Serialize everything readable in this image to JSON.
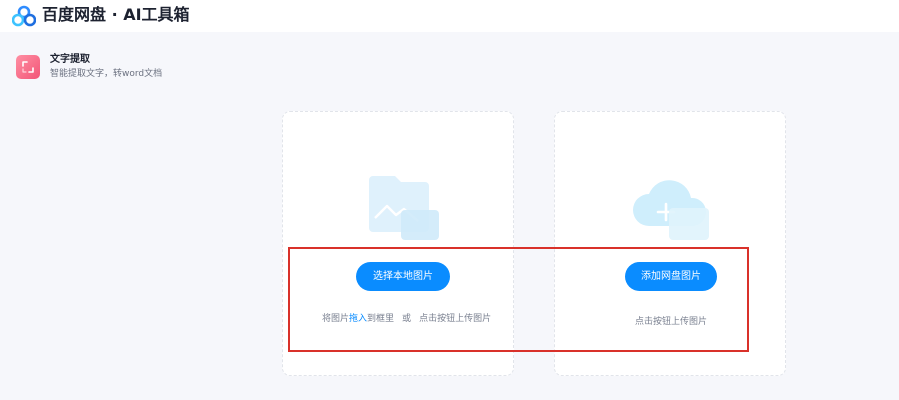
{
  "header": {
    "brand": "百度网盘 · AI工具箱",
    "logo_icon": "baidu-netdisk-cloud-icon"
  },
  "tool": {
    "title": "文字提取",
    "description": "智能提取文字，转word文档",
    "icon": "ocr-scan-icon",
    "icon_color": "#f25577"
  },
  "local_card": {
    "illustration_icon": "image-file-icon",
    "button_label": "选择本地图片",
    "hint_prefix": "将图片",
    "hint_link": "拖入",
    "hint_suffix": "到框里",
    "hint_or": "或",
    "hint_click": "点击按钮上传图片"
  },
  "cloud_card": {
    "illustration_icon": "cloud-add-icon",
    "button_label": "添加网盘图片",
    "hint": "点击按钮上传图片"
  },
  "colors": {
    "accent": "#0a8cff",
    "highlight_border": "#d9312a"
  }
}
